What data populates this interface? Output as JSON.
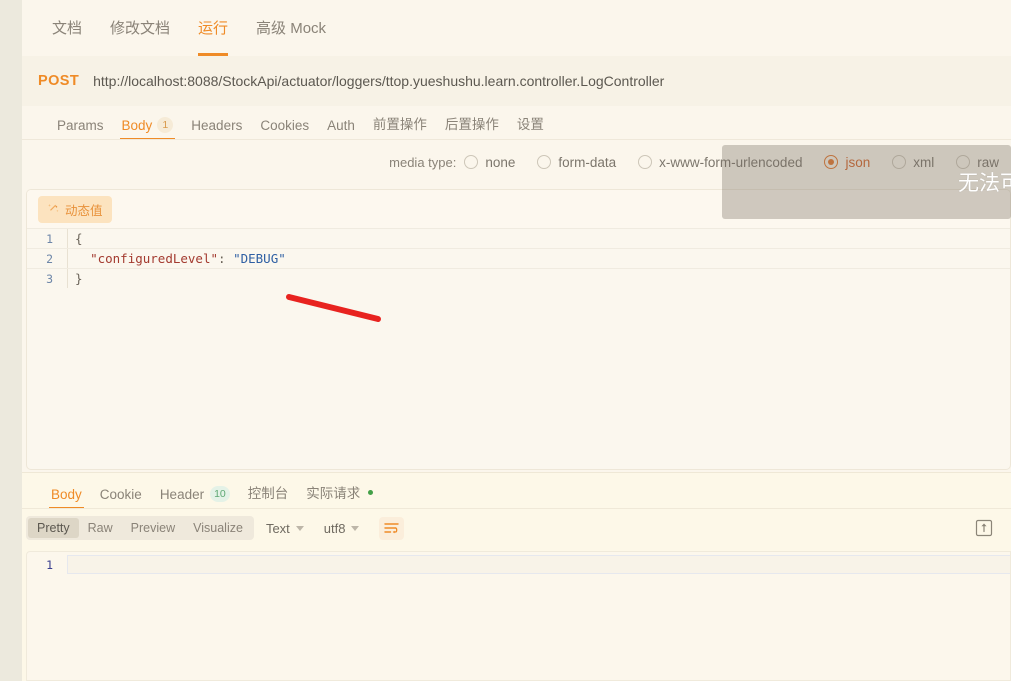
{
  "top_tabs": [
    {
      "label": "文档",
      "active": false
    },
    {
      "label": "修改文档",
      "active": false
    },
    {
      "label": "运行",
      "active": true
    },
    {
      "label": "高级 Mock",
      "active": false
    }
  ],
  "url_bar": {
    "method": "POST",
    "url": "http://localhost:8088/StockApi/actuator/loggers/ttop.yueshushu.learn.controller.LogController"
  },
  "request_tabs": [
    {
      "label": "Params",
      "badge": "",
      "active": false
    },
    {
      "label": "Body",
      "badge": "1",
      "active": true
    },
    {
      "label": "Headers",
      "badge": "",
      "active": false
    },
    {
      "label": "Cookies",
      "badge": "",
      "active": false
    },
    {
      "label": "Auth",
      "badge": "",
      "active": false
    },
    {
      "label": "前置操作",
      "badge": "",
      "active": false
    },
    {
      "label": "后置操作",
      "badge": "",
      "active": false
    },
    {
      "label": "设置",
      "badge": "",
      "active": false
    }
  ],
  "media_type": {
    "label": "media type:",
    "options": [
      {
        "label": "none",
        "selected": false
      },
      {
        "label": "form-data",
        "selected": false
      },
      {
        "label": "x-www-form-urlencoded",
        "selected": false
      },
      {
        "label": "json",
        "selected": true
      },
      {
        "label": "xml",
        "selected": false
      },
      {
        "label": "raw",
        "selected": false
      }
    ]
  },
  "body_editor": {
    "dynamic_value_label": "动态值",
    "lines": [
      {
        "num": "1",
        "text": "{"
      },
      {
        "num": "2",
        "key": "\"configuredLevel\"",
        "sep": ": ",
        "value": "\"DEBUG\""
      },
      {
        "num": "3",
        "text": "}"
      }
    ]
  },
  "overlay": {
    "text": "无法可"
  },
  "response_tabs": [
    {
      "label": "Body",
      "badge": "",
      "active": true
    },
    {
      "label": "Cookie",
      "badge": "",
      "active": false
    },
    {
      "label": "Header",
      "badge": "10",
      "active": false
    },
    {
      "label": "控制台",
      "badge": "",
      "active": false
    },
    {
      "label": "实际请求",
      "badge": "",
      "active": false,
      "dot": true
    }
  ],
  "response_toolbar": {
    "view_modes": [
      {
        "label": "Pretty",
        "active": true
      },
      {
        "label": "Raw",
        "active": false
      },
      {
        "label": "Preview",
        "active": false
      },
      {
        "label": "Visualize",
        "active": false
      }
    ],
    "format": "Text",
    "encoding": "utf8",
    "wrap_icon": "wrap-text-icon",
    "expand_icon": "expand-panel-icon"
  },
  "response_body": {
    "lines": [
      {
        "num": "1",
        "text": ""
      }
    ]
  },
  "colors": {
    "accent": "#ef8b27",
    "accent_selected": "#e4762c",
    "page_bg": "#fbf6ec",
    "response_bg": "#fdf8e8",
    "annotation": "#e8231f",
    "green_dot": "#43a047"
  }
}
